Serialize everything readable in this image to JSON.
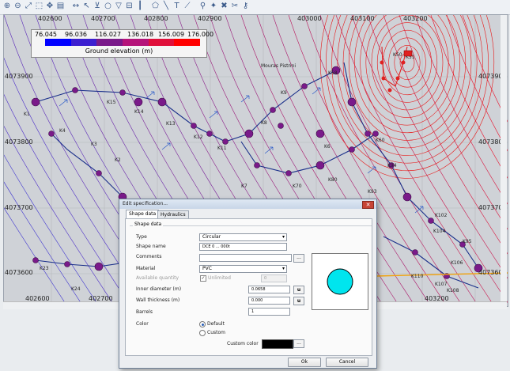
{
  "toolbar": {
    "icons": [
      "zoom-in-icon",
      "zoom-out-icon",
      "zoom-extent-icon",
      "zoom-window-icon",
      "pan-icon",
      "layers-icon",
      "measure-icon",
      "select-icon",
      "filter-icon",
      "node-icon",
      "pipe-icon",
      "valve-icon",
      "hydrant-icon",
      "polygon-icon",
      "line-tool-icon",
      "text-tool-icon",
      "profile-icon",
      "trace-icon",
      "snap-icon",
      "delete-icon",
      "split-icon",
      "key-icon"
    ]
  },
  "map": {
    "x_labels_top": [
      "402600",
      "402700",
      "402800",
      "402900",
      "403000",
      "403100",
      "403200"
    ],
    "x_labels_bottom": [
      "402600",
      "402700",
      "403200"
    ],
    "y_labels_left": [
      "4073900",
      "4073800",
      "4073700",
      "4073600"
    ],
    "y_labels_right": [
      "4073900",
      "4073800",
      "4073700",
      "4073600"
    ],
    "node_labels": [
      "K1",
      "K15",
      "K14",
      "K13",
      "K12",
      "K11",
      "K9",
      "K8",
      "K7",
      "K6",
      "K70",
      "K80",
      "K93",
      "K94",
      "K60",
      "K102",
      "K104",
      "K95",
      "K106",
      "K110",
      "K107",
      "K108",
      "K58",
      "K51",
      "K50",
      "K23",
      "K24",
      "K4",
      "K3",
      "K2"
    ],
    "place_label": "Mouras Pistrini"
  },
  "legend": {
    "ticks": [
      "76.045",
      "96.036",
      "116.027",
      "136.018",
      "156.009",
      "176.000"
    ],
    "colors": [
      "#0000ff",
      "#3c1fd0",
      "#7a1a8a",
      "#b5147a",
      "#e0103a",
      "#ff0000"
    ],
    "title": "Ground elevation (m)"
  },
  "dialog": {
    "title": "Edit specification...",
    "close_glyph": "✕",
    "tabs": [
      "Shape data",
      "Hydraulics"
    ],
    "group_label": "Shape data",
    "type_label": "Type",
    "type_value": "Circular",
    "shape_name_label": "Shape name",
    "shape_name_value": "DCE 0 ... 000t",
    "comments_label": "Comments",
    "comments_value": "",
    "material_label": "Material",
    "material_value": "PVC",
    "avail_qty_label": "Available quantity",
    "unlimited_label": "Unlimited",
    "avail_qty_value": "0",
    "inner_diam_label": "Inner diameter (m)",
    "inner_diam_value": "0.0658",
    "wall_label": "Wall thickness (m)",
    "wall_value": "0.000",
    "barrels_label": "Barrels",
    "barrels_value": "1",
    "color_label": "Color",
    "default_label": "Default",
    "custom_label": "Custom",
    "custom_color_label": "Custom color",
    "custom_color": "#000000",
    "unit_btn": "u",
    "dots_btn": "...",
    "ok_label": "Ok",
    "cancel_label": "Cancel",
    "preview_fill": "#00e5ee"
  }
}
